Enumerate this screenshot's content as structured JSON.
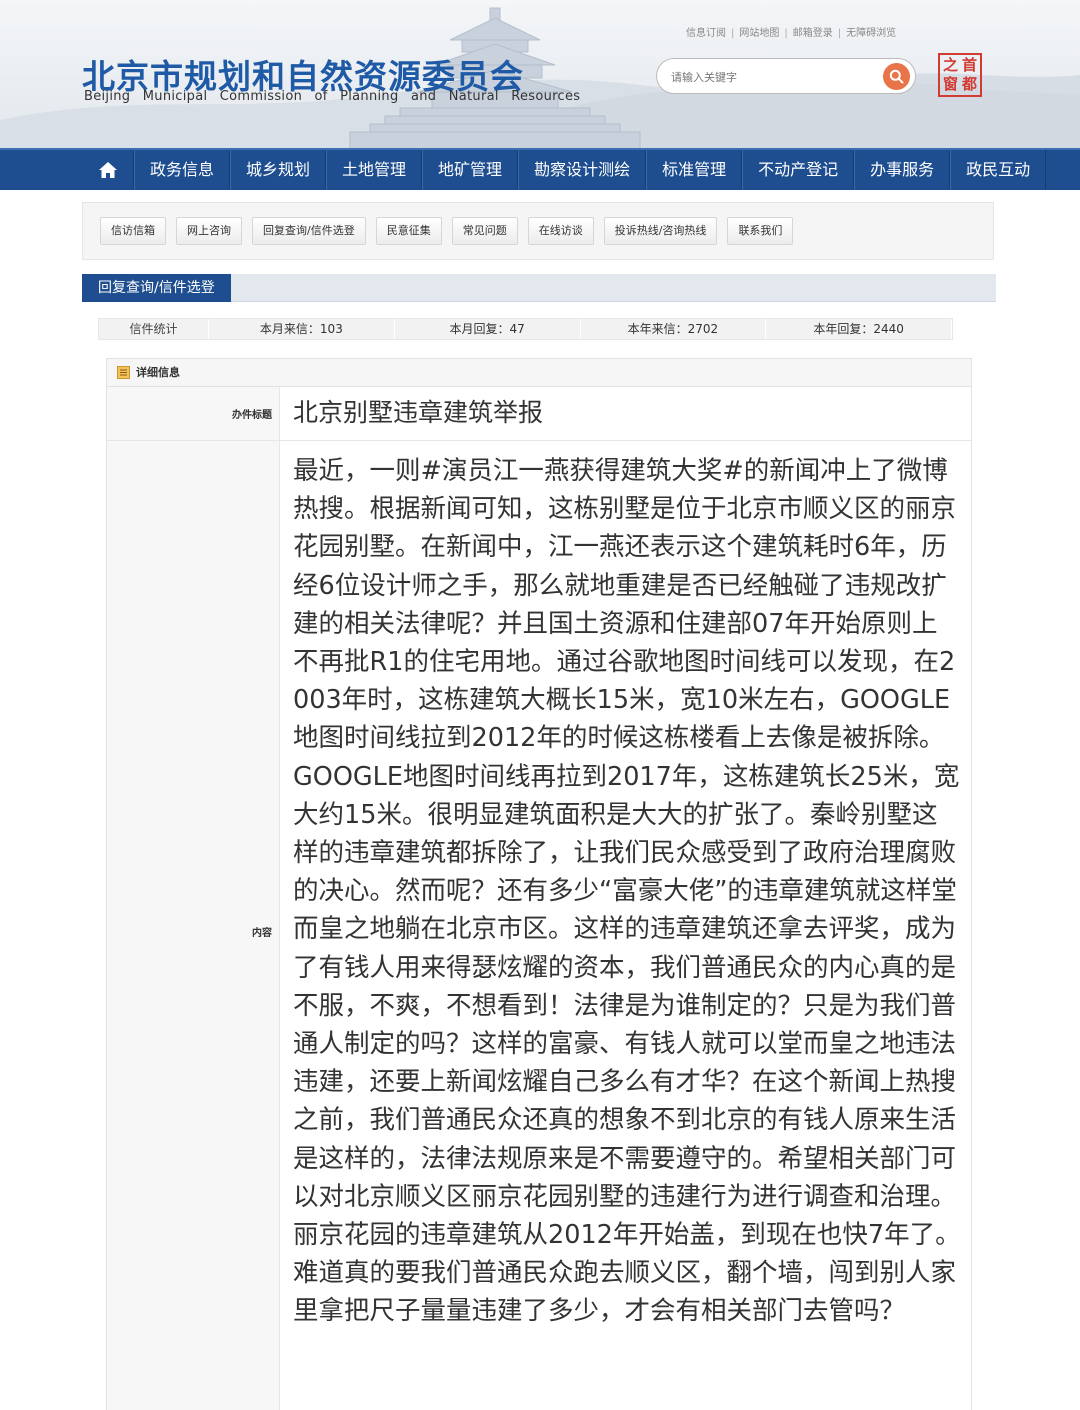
{
  "header": {
    "title": "北京市规划和自然资源委员会",
    "subtitle": "Beijing Municipal Commission of Planning and Natural Resources",
    "top_links": [
      "信息订阅",
      "网站地图",
      "邮箱登录",
      "无障碍浏览"
    ],
    "search_placeholder": "请输入关键字",
    "seal_chars": [
      "首",
      "之",
      "都",
      "窗"
    ]
  },
  "nav": {
    "items": [
      "政务信息",
      "城乡规划",
      "土地管理",
      "地矿管理",
      "勘察设计测绘",
      "标准管理",
      "不动产登记",
      "办事服务",
      "政民互动"
    ]
  },
  "subnav": {
    "items": [
      "信访信箱",
      "网上咨询",
      "回复查询/信件选登",
      "民意征集",
      "常见问题",
      "在线访谈",
      "投诉热线/咨询热线",
      "联系我们"
    ]
  },
  "section": {
    "title": "回复查询/信件选登"
  },
  "stats": {
    "label": "信件统计",
    "month_letters": "本月来信：103",
    "month_replies": "本月回复：47",
    "year_letters": "本年来信：2702",
    "year_replies": "本年回复：2440"
  },
  "detail": {
    "heading": "详细信息",
    "title_label": "办件标题",
    "title_value": "北京别墅违章建筑举报",
    "content_label": "内容",
    "content_value": "最近，一则#演员江一燕获得建筑大奖#的新闻冲上了微博热搜。根据新闻可知，这栋别墅是位于北京市顺义区的丽京花园别墅。在新闻中，江一燕还表示这个建筑耗时6年，历经6位设计师之手，那么就地重建是否已经触碰了违规改扩建的相关法律呢？并且国土资源和住建部07年开始原则上不再批R1的住宅用地。通过谷歌地图时间线可以发现，在2003年时，这栋建筑大概长15米，宽10米左右，GOOGLE地图时间线拉到2012年的时候这栋楼看上去像是被拆除。GOOGLE地图时间线再拉到2017年，这栋建筑长25米，宽大约15米。很明显建筑面积是大大的扩张了。秦岭别墅这样的违章建筑都拆除了，让我们民众感受到了政府治理腐败的决心。然而呢？还有多少“富豪大佬”的违章建筑就这样堂而皇之地躺在北京市区。这样的违章建筑还拿去评奖，成为了有钱人用来得瑟炫耀的资本，我们普通民众的内心真的是不服，不爽，不想看到！法律是为谁制定的？只是为我们普通人制定的吗？这样的富豪、有钱人就可以堂而皇之地违法违建，还要上新闻炫耀自己多么有才华？在这个新闻上热搜之前，我们普通民众还真的想象不到北京的有钱人原来生活是这样的，法律法规原来是不需要遵守的。希望相关部门可以对北京顺义区丽京花园别墅的违建行为进行调查和治理。丽京花园的违章建筑从2012年开始盖，到现在也快7年了。难道真的要我们普通民众跑去顺义区，翻个墙，闯到别人家里拿把尺子量量违建了多少，才会有相关部门去管吗？"
  },
  "colors": {
    "brand_blue": "#1e4e8f",
    "title_blue": "#1f5aa6",
    "search_orange": "#e8744a",
    "seal_red": "#d23b32"
  }
}
